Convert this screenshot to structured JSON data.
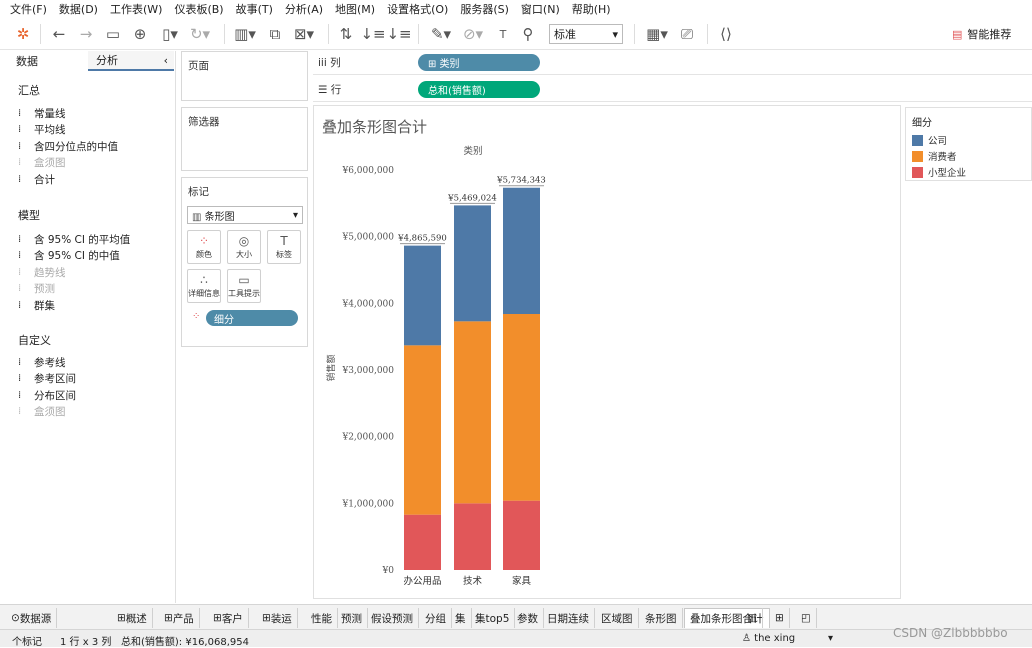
{
  "menu": [
    "文件(F)",
    "数据(D)",
    "工作表(W)",
    "仪表板(B)",
    "故事(T)",
    "分析(A)",
    "地图(M)",
    "设置格式(O)",
    "服务器(S)",
    "窗口(N)",
    "帮助(H)"
  ],
  "toolbar": {
    "mark_type_select": "标准",
    "smart_label": "智能推荐"
  },
  "left_pane": {
    "tab_data": "数据",
    "tab_analysis": "分析",
    "sections": {
      "summary": "汇总",
      "model": "模型",
      "custom": "自定义"
    },
    "summary_items": [
      {
        "label": "常量线",
        "enabled": true
      },
      {
        "label": "平均线",
        "enabled": true
      },
      {
        "label": "含四分位点的中值",
        "enabled": true
      },
      {
        "label": "盒须图",
        "enabled": false
      },
      {
        "label": "合计",
        "enabled": true
      }
    ],
    "model_items": [
      {
        "label": "含 95% CI 的平均值",
        "enabled": true
      },
      {
        "label": "含 95% CI 的中值",
        "enabled": true
      },
      {
        "label": "趋势线",
        "enabled": false
      },
      {
        "label": "预测",
        "enabled": false
      },
      {
        "label": "群集",
        "enabled": true
      }
    ],
    "custom_items": [
      {
        "label": "参考线",
        "enabled": true
      },
      {
        "label": "参考区间",
        "enabled": true
      },
      {
        "label": "分布区间",
        "enabled": true
      },
      {
        "label": "盒须图",
        "enabled": false
      }
    ]
  },
  "cards": {
    "pages": "页面",
    "filters": "筛选器",
    "marks": "标记",
    "mark_type": "条形图",
    "mark_buttons": [
      "颜色",
      "大小",
      "标签",
      "详细信息",
      "工具提示"
    ],
    "color_pill": "细分"
  },
  "shelves": {
    "columns_label": "列",
    "columns_pill": "⊞ 类别",
    "rows_label": "行",
    "rows_pill": "总和(销售额)"
  },
  "legend": {
    "title": "细分",
    "items": [
      {
        "label": "公司",
        "color": "#4e79a7"
      },
      {
        "label": "消费者",
        "color": "#f28e2b"
      },
      {
        "label": "小型企业",
        "color": "#e15759"
      }
    ]
  },
  "chart_data": {
    "type": "bar",
    "stacked": true,
    "title": "叠加条形图合计",
    "column_header": "类别",
    "ylabel": "销售额",
    "categories": [
      "办公用品",
      "技术",
      "家具"
    ],
    "series": [
      {
        "name": "小型企业",
        "color": "#e15759",
        "values": [
          830000,
          1000000,
          1040000
        ]
      },
      {
        "name": "消费者",
        "color": "#f28e2b",
        "values": [
          2540000,
          2730000,
          2800000
        ]
      },
      {
        "name": "公司",
        "color": "#4e79a7",
        "values": [
          1495590,
          1739024,
          1894343
        ]
      }
    ],
    "totals": [
      "¥4,865,590",
      "¥5,469,024",
      "¥5,734,343"
    ],
    "ylim": [
      0,
      6200000
    ],
    "yticks": [
      0,
      1000000,
      2000000,
      3000000,
      4000000,
      5000000,
      6000000
    ],
    "ytick_labels": [
      "¥0",
      "¥1,000,000",
      "¥2,000,000",
      "¥3,000,000",
      "¥4,000,000",
      "¥5,000,000",
      "¥6,000,000"
    ]
  },
  "sheet_tabs": {
    "datasource": "数据源",
    "tabs": [
      "概述",
      "产品",
      "客户",
      "装运",
      "性能",
      "预测",
      "假设预测",
      "分组",
      "集",
      "集top5",
      "参数",
      "日期连续",
      "区域图",
      "条形图",
      "叠加条形图合计"
    ],
    "active": "叠加条形图合计"
  },
  "status": {
    "marks": "个标记",
    "rows_cols": "1 行 x 3 列",
    "sum": "总和(销售额): ¥16,068,954",
    "user": "the xing"
  },
  "watermark": "CSDN @Zlbbbbbbo"
}
